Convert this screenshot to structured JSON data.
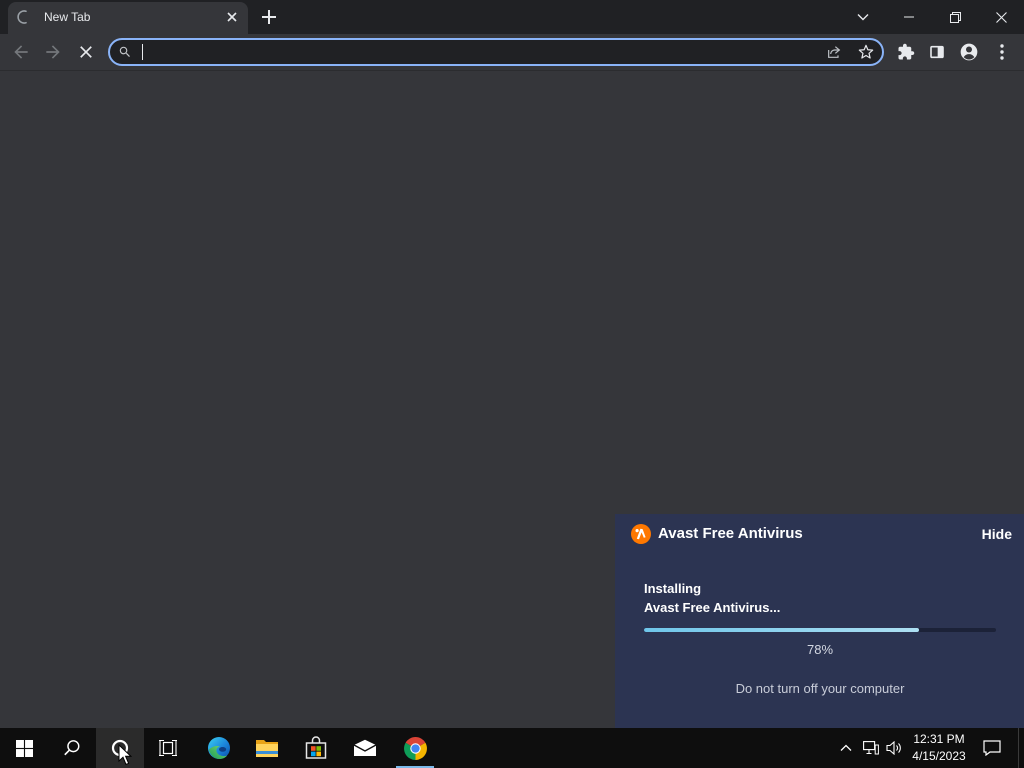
{
  "colors": {
    "frame": "#202124",
    "toolbar": "#35363a",
    "omnibox_focus": "#8ab4f8",
    "avast_panel": "#2c3452",
    "avast_orange": "#ff7800",
    "progress_track": "#1c2238",
    "progress_fill": "#aee0f3",
    "taskbar": "#0e0e0e",
    "taskbar_hover": "#2b2b2b",
    "taskbar_active_indicator": "#7ab9ea"
  },
  "browser": {
    "tab": {
      "title": "New Tab",
      "loading": true,
      "icon": "loading-spinner-icon",
      "close_icon": "close-icon"
    },
    "new_tab_icon": "plus-icon",
    "window_controls": [
      "chevron-down-icon",
      "minimize-icon",
      "restore-icon",
      "close-icon"
    ],
    "nav": {
      "back_enabled": false,
      "forward_enabled": false,
      "back_icon": "arrow-back-icon",
      "forward_icon": "arrow-forward-icon",
      "stop_icon": "close-icon"
    },
    "omnibox": {
      "value": "",
      "placeholder": "",
      "focused": true,
      "icons": [
        "search-icon",
        "share-icon",
        "star-icon"
      ]
    },
    "toolbar_icons": [
      "puzzle-icon",
      "side-panel-icon",
      "profile-icon",
      "more-vert-icon"
    ]
  },
  "avast": {
    "app_name": "Avast Free Antivirus",
    "logo_icon": "avast-logo-icon",
    "hide_label": "Hide",
    "status_line1": "Installing",
    "status_line2": "Avast Free Antivirus...",
    "progress_percent": 78,
    "progress_label": "78%",
    "warning": "Do not turn off your computer"
  },
  "taskbar": {
    "buttons": [
      {
        "icon": "windows-logo-icon"
      },
      {
        "icon": "search-icon"
      },
      {
        "icon": "cortana-icon",
        "hovered": true
      },
      {
        "icon": "task-view-icon"
      },
      {
        "icon": "edge-icon"
      },
      {
        "icon": "file-explorer-icon"
      },
      {
        "icon": "store-icon"
      },
      {
        "icon": "mail-icon"
      },
      {
        "icon": "chrome-icon",
        "active": true
      }
    ],
    "tray_icons": [
      "chevron-up-icon",
      "network-icon",
      "volume-icon",
      "notification-icon"
    ],
    "time": "12:31 PM",
    "date": "4/15/2023",
    "cursor_icon": "mouse-pointer-icon"
  }
}
